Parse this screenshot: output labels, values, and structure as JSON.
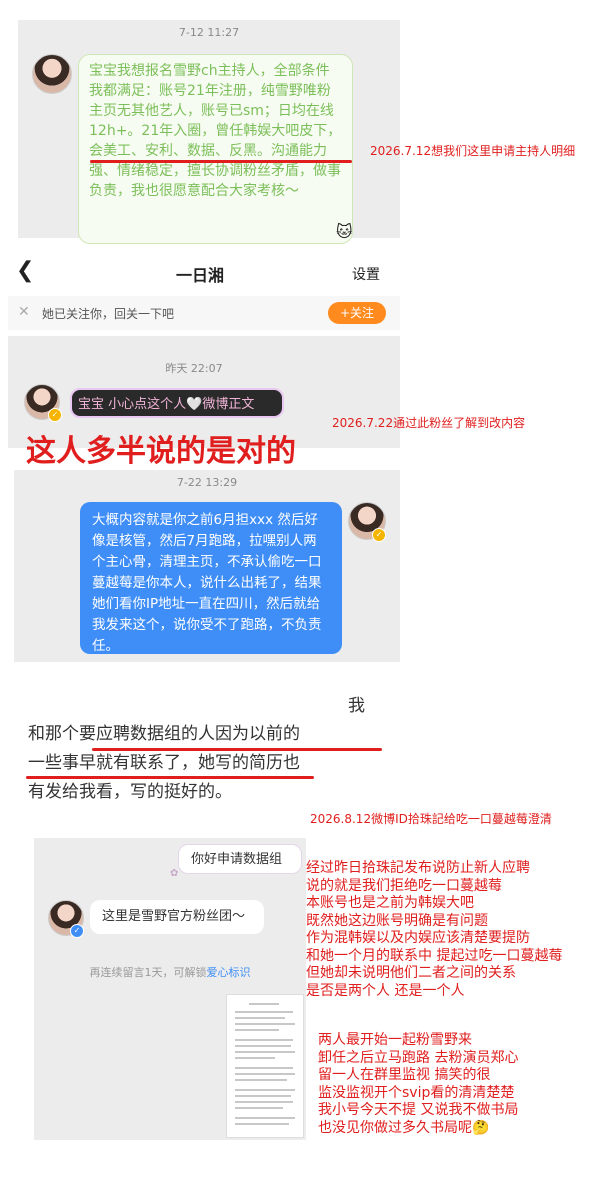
{
  "panel1": {
    "timestamp": "7-12 11:27",
    "message": "宝宝我想报名雪野ch主持人，全部条件我都满足：账号21年注册，纯雪野唯粉主页无其他艺人，账号已sm；日均在线12h+。21年入圈，曾任韩娱大吧皮下，会美工、安利、数据、反黑。沟通能力强、情绪稳定，擅长协调粉丝矛盾，做事负责，我也很愿意配合大家考核～",
    "note": "2026.7.12想我们这里申请主持人明细"
  },
  "chat_header": {
    "back_icon": "chevron-left-icon",
    "title": "一日湘",
    "settings_label": "设置"
  },
  "follow_bar": {
    "text": "她已关注你，回关一下吧",
    "button_label": "+关注"
  },
  "panel2": {
    "timestamp": "昨天 22:07",
    "message": "宝宝 小心点这个人🤍微博正文",
    "note": "2026.7.22通过此粉丝了解到改内容",
    "big_red_text": "这人多半说的是对的"
  },
  "panel3": {
    "timestamp": "7-22 13:29",
    "message": "大概内容就是你之前6月担xxx 然后好像是核管，然后7月跑路，拉嘿别人两个主心骨，清理主页，不承认偷吃一口蔓越莓是你本人，说什么出耗了，结果她们看你IP地址一直在四川，然后就给我发来这个，说你受不了跑路，不负责任。"
  },
  "panel4": {
    "lines": [
      "我",
      "和那个要应聘数据组的人因为以前的",
      "一些事早就有联系了，她写的简历也",
      "有发给我看，写的挺好的。"
    ],
    "note": "2026.8.12微博ID拾珠記给吃一口蔓越莓澄清"
  },
  "panel5": {
    "apply_bubble": "你好申请数据组",
    "fan_bubble": "这里是雪野官方粉丝团～",
    "notice": "再连续留言1天，可解锁",
    "notice_link": "爱心标识"
  },
  "right_notes": {
    "block1": [
      "经过昨日拾珠記发布说防止新人应聘",
      "说的就是我们拒绝吃一口蔓越莓",
      "本账号也是之前为韩娱大吧",
      "既然她这边账号明确是有问题",
      "作为混韩娱以及内娱应该清楚要提防",
      "和她一个月的联系中 提起过吃一口蔓越莓",
      "但她却未说明他们二者之间的关系",
      "是否是两个人 还是一个人"
    ],
    "block2": [
      "两人最开始一起粉雪野来",
      "卸任之后立马跑路 去粉演员郑心",
      "留一人在群里监视 搞笑的很",
      "监没监视开个svip看的清清楚楚",
      "我小号今天不提 又说我不做书局",
      "也没见你做过多久书局呢🤔"
    ]
  },
  "colors": {
    "green_text": "#7cbf5a",
    "blue_bubble": "#3f8ef7",
    "red": "#e01e1e",
    "orange_button": "#ff8a1e",
    "panel_gray": "#ececec"
  }
}
